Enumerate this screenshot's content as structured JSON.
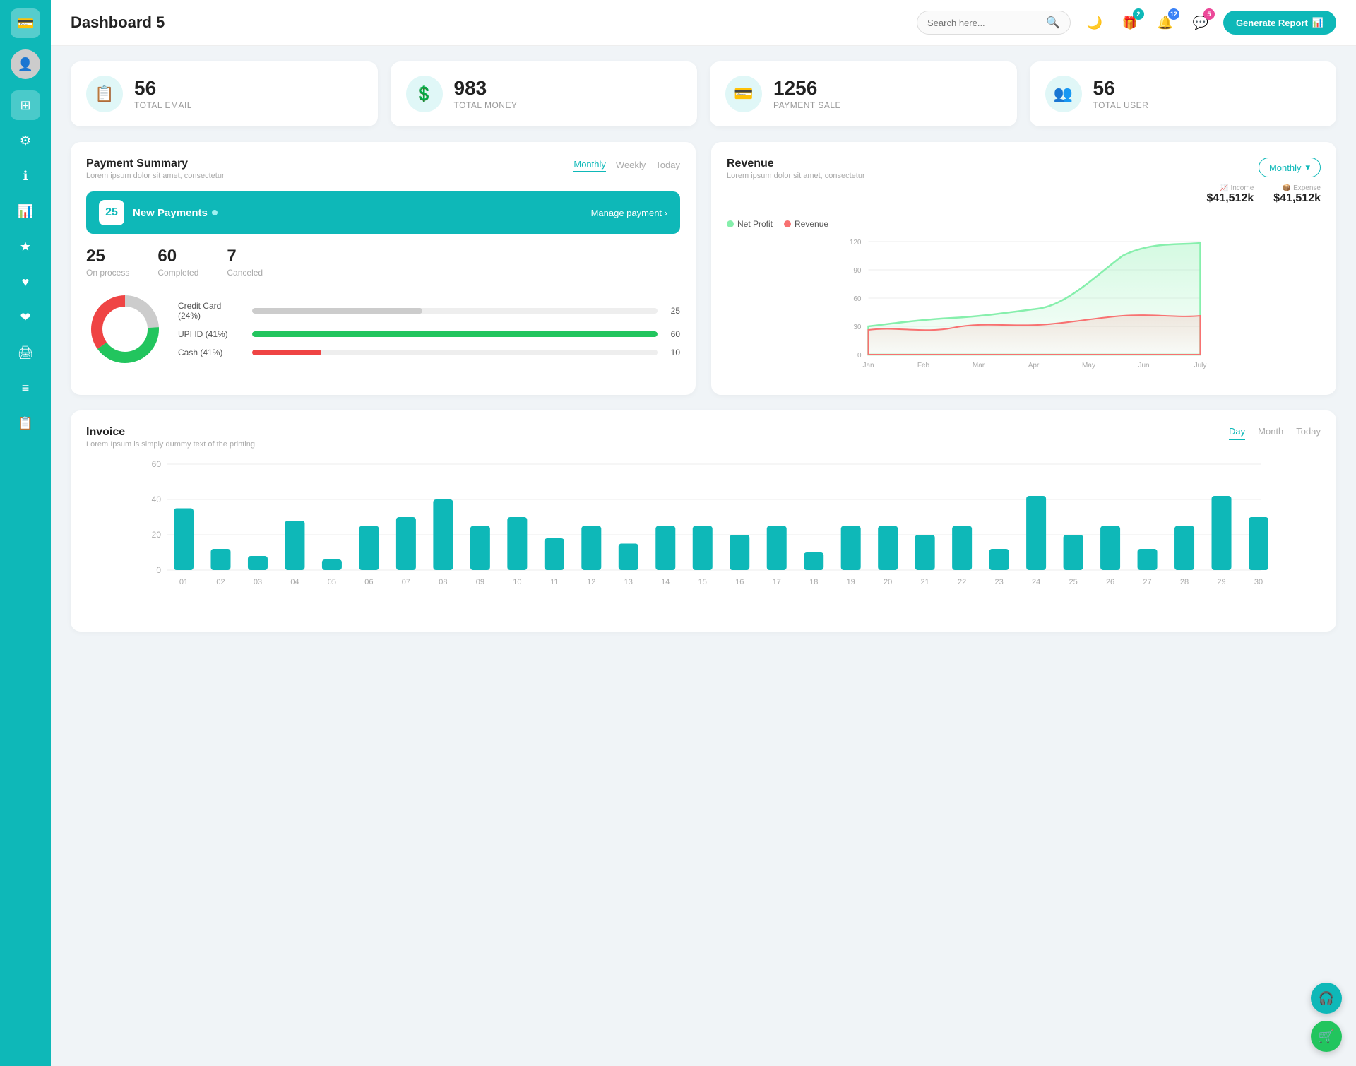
{
  "sidebar": {
    "logo_icon": "💳",
    "items": [
      {
        "id": "avatar",
        "icon": "👤",
        "active": false,
        "is_avatar": true
      },
      {
        "id": "dashboard",
        "icon": "⊞",
        "active": true
      },
      {
        "id": "settings",
        "icon": "⚙",
        "active": false
      },
      {
        "id": "info",
        "icon": "ℹ",
        "active": false
      },
      {
        "id": "chart",
        "icon": "📊",
        "active": false
      },
      {
        "id": "star",
        "icon": "★",
        "active": false
      },
      {
        "id": "heart1",
        "icon": "♥",
        "active": false
      },
      {
        "id": "heart2",
        "icon": "❤",
        "active": false
      },
      {
        "id": "print",
        "icon": "🖨",
        "active": false
      },
      {
        "id": "menu",
        "icon": "≡",
        "active": false
      },
      {
        "id": "list",
        "icon": "📋",
        "active": false
      }
    ]
  },
  "header": {
    "title": "Dashboard 5",
    "search_placeholder": "Search here...",
    "icons": {
      "moon": "🌙",
      "gift_badge": "2",
      "bell_badge": "12",
      "chat_badge": "5"
    },
    "generate_btn": "Generate Report"
  },
  "stat_cards": [
    {
      "id": "email",
      "number": "56",
      "label": "TOTAL EMAIL",
      "icon": "📋"
    },
    {
      "id": "money",
      "number": "983",
      "label": "TOTAL MONEY",
      "icon": "💲"
    },
    {
      "id": "payment",
      "number": "1256",
      "label": "PAYMENT SALE",
      "icon": "💳"
    },
    {
      "id": "user",
      "number": "56",
      "label": "TOTAL USER",
      "icon": "👥"
    }
  ],
  "payment_summary": {
    "title": "Payment Summary",
    "subtitle": "Lorem ipsum dolor sit amet, consectetur",
    "tabs": [
      "Monthly",
      "Weekly",
      "Today"
    ],
    "active_tab": "Monthly",
    "new_payments_count": "25",
    "new_payments_label": "New Payments",
    "manage_link": "Manage payment",
    "stats": [
      {
        "num": "25",
        "label": "On process"
      },
      {
        "num": "60",
        "label": "Completed"
      },
      {
        "num": "7",
        "label": "Canceled"
      }
    ],
    "bars": [
      {
        "label": "Credit Card (24%)",
        "value": 25,
        "max": 60,
        "color": "#cccccc",
        "display": "25"
      },
      {
        "label": "UPI ID (41%)",
        "value": 60,
        "max": 60,
        "color": "#22c55e",
        "display": "60"
      },
      {
        "label": "Cash (41%)",
        "value": 10,
        "max": 60,
        "color": "#ef4444",
        "display": "10"
      }
    ],
    "donut": {
      "segments": [
        {
          "color": "#cccccc",
          "pct": 24
        },
        {
          "color": "#22c55e",
          "pct": 41
        },
        {
          "color": "#ef4444",
          "pct": 35
        }
      ]
    }
  },
  "revenue": {
    "title": "Revenue",
    "subtitle": "Lorem ipsum dolor sit amet, consectetur",
    "period_label": "Monthly",
    "income": {
      "label": "Income",
      "value": "$41,512k",
      "icon": "📈"
    },
    "expense": {
      "label": "Expense",
      "value": "$41,512k",
      "icon": "📦"
    },
    "legend": [
      {
        "label": "Net Profit",
        "color": "#86efac"
      },
      {
        "label": "Revenue",
        "color": "#f87171"
      }
    ],
    "x_labels": [
      "Jan",
      "Feb",
      "Mar",
      "Apr",
      "May",
      "Jun",
      "July"
    ],
    "y_labels": [
      "0",
      "30",
      "60",
      "90",
      "120"
    ]
  },
  "invoice": {
    "title": "Invoice",
    "subtitle": "Lorem Ipsum is simply dummy text of the printing",
    "tabs": [
      "Day",
      "Month",
      "Today"
    ],
    "active_tab": "Day",
    "y_labels": [
      "0",
      "20",
      "40",
      "60"
    ],
    "x_labels": [
      "01",
      "02",
      "03",
      "04",
      "05",
      "06",
      "07",
      "08",
      "09",
      "10",
      "11",
      "12",
      "13",
      "14",
      "15",
      "16",
      "17",
      "18",
      "19",
      "20",
      "21",
      "22",
      "23",
      "24",
      "25",
      "26",
      "27",
      "28",
      "29",
      "30"
    ],
    "bars": [
      35,
      12,
      8,
      28,
      6,
      25,
      30,
      40,
      25,
      30,
      18,
      25,
      15,
      25,
      25,
      20,
      25,
      10,
      25,
      25,
      20,
      25,
      12,
      42,
      20,
      25,
      12,
      25,
      42,
      30
    ]
  },
  "float_btns": {
    "support_icon": "🎧",
    "cart_icon": "🛒"
  },
  "colors": {
    "teal": "#0eb8b8",
    "green": "#22c55e",
    "red": "#ef4444",
    "gray": "#cccccc"
  }
}
